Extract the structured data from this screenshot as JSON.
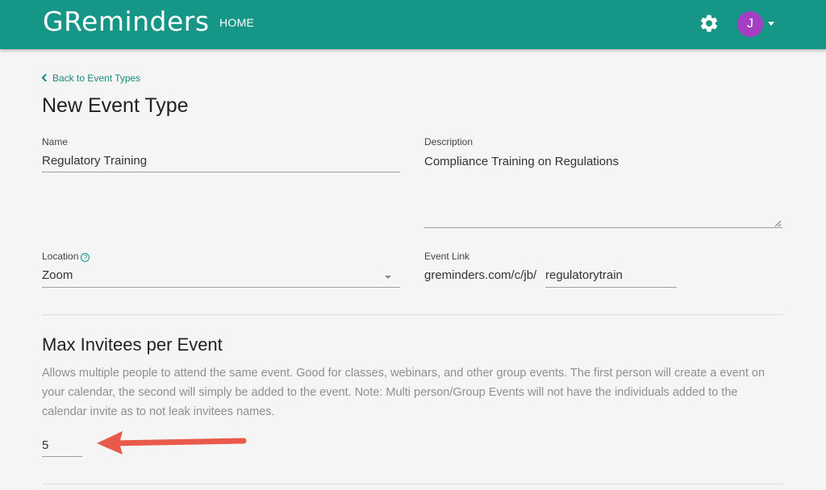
{
  "header": {
    "brand": "GReminders",
    "nav_home": "HOME",
    "avatar_initial": "J",
    "accent_color": "#159686",
    "avatar_color": "#a43fc4"
  },
  "back_link": "Back to Event Types",
  "page_title": "New Event Type",
  "form": {
    "name": {
      "label": "Name",
      "value": "Regulatory Training"
    },
    "description": {
      "label": "Description",
      "value": "Compliance Training on Regulations"
    },
    "location": {
      "label": "Location",
      "value": "Zoom",
      "help_icon": "?"
    },
    "event_link": {
      "label": "Event Link",
      "prefix": "greminders.com/c/jb/",
      "value": "regulatorytrain"
    }
  },
  "max_invitees": {
    "title": "Max Invitees per Event",
    "description": "Allows multiple people to attend the same event. Good for classes, webinars, and other group events. The first person will create a event on your calendar, the second will simply be added to the event. Note: Multi person/Group Events will not have the individuals added to the calendar invite as to not leak invitees names.",
    "value": "5"
  },
  "icons": [
    "gear-icon",
    "chevron-left-icon",
    "help-icon",
    "dropdown-caret-icon",
    "resize-handle-icon",
    "annotation-arrow"
  ]
}
